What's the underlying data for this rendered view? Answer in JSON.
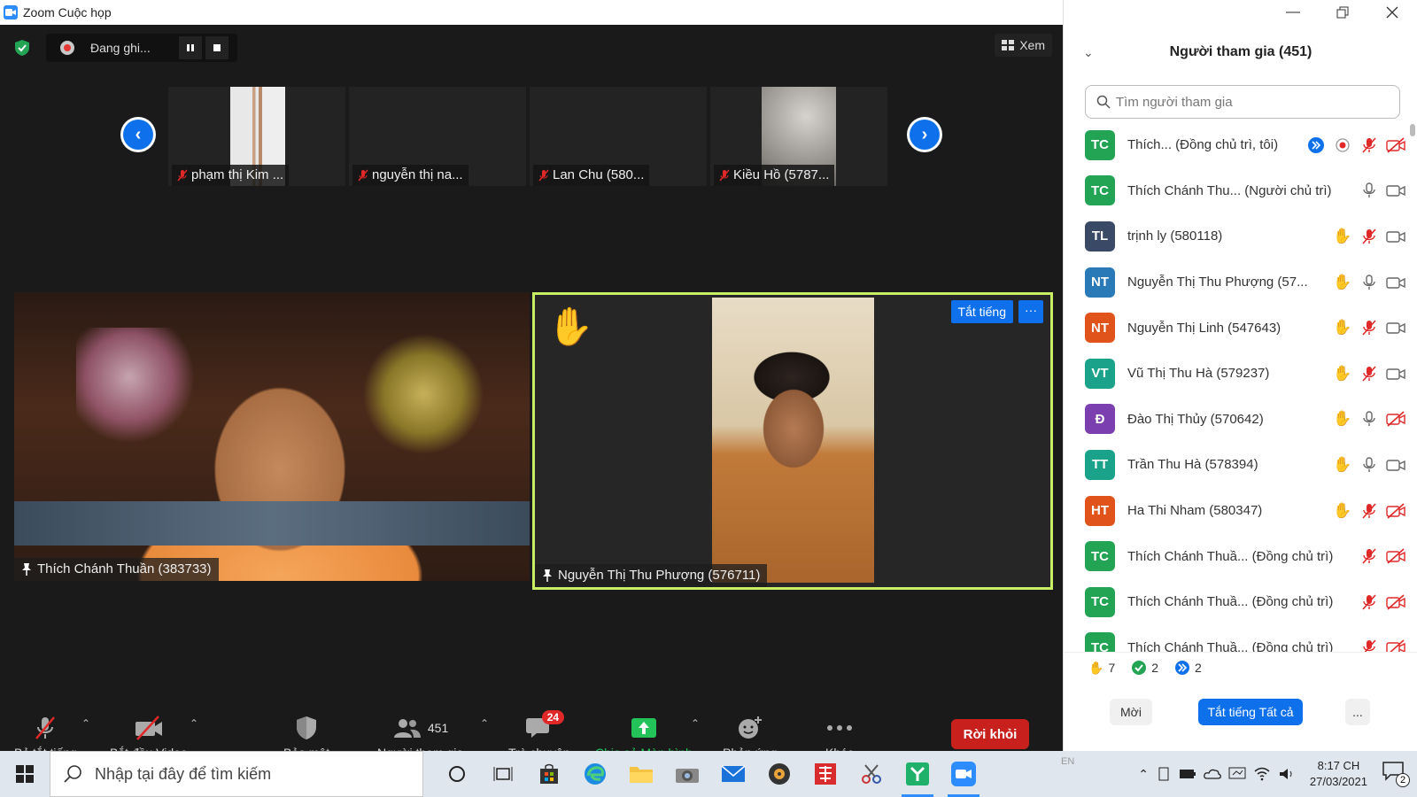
{
  "window": {
    "title": "Zoom Cuộc họp"
  },
  "topbar": {
    "recording_label": "Đang ghi...",
    "view_label": "Xem"
  },
  "gallery_strip": [
    {
      "name": "phạm thị Kim ..."
    },
    {
      "name": "nguyễn thị na..."
    },
    {
      "name": "Lan Chu (580..."
    },
    {
      "name": "Kiều Hồ (5787..."
    }
  ],
  "main_tiles": {
    "left": {
      "name": "Thích Chánh Thuần (383733)"
    },
    "right": {
      "name": "Nguyễn Thị Thu Phượng (576711)",
      "mute_label": "Tắt tiếng",
      "more_label": "···"
    }
  },
  "toolbar": {
    "mute_label": "Bỏ tắt tiếng",
    "video_label": "Bắt đầu Video",
    "security_label": "Bảo mật",
    "participants_label": "Người tham gia",
    "participants_count": "451",
    "chat_label": "Trò chuyện",
    "chat_badge": "24",
    "share_label": "Chia sẻ Màn hình",
    "reactions_label": "Phản ứng",
    "more_label": "Khác",
    "leave_label": "Rời khỏi"
  },
  "panel": {
    "title": "Người tham gia (451)",
    "search_placeholder": "Tìm người tham gia",
    "participants": [
      {
        "initials": "TC",
        "color": "#23a455",
        "name": "Thích... (Đồng chủ trì, tôi)",
        "hand": false,
        "mic": "muted",
        "video": "off",
        "extra": "cohost-self"
      },
      {
        "initials": "TC",
        "color": "#23a455",
        "name": "Thích Chánh Thu... (Người chủ trì)",
        "hand": false,
        "mic": "on",
        "video": "on",
        "extra": ""
      },
      {
        "initials": "TL",
        "color": "#3a4a66",
        "name": "trịnh ly (580118)",
        "hand": true,
        "mic": "muted",
        "video": "on",
        "extra": ""
      },
      {
        "initials": "NT",
        "color": "#2a7ab8",
        "name": "Nguyễn Thị Thu Phượng (57...",
        "hand": true,
        "mic": "on",
        "video": "on",
        "extra": ""
      },
      {
        "initials": "NT",
        "color": "#e0541c",
        "name": "Nguyễn Thị Linh (547643)",
        "hand": true,
        "mic": "muted",
        "video": "on",
        "extra": ""
      },
      {
        "initials": "VT",
        "color": "#1aa38a",
        "name": "Vũ Thị Thu Hà  (579237)",
        "hand": true,
        "mic": "muted",
        "video": "on",
        "extra": ""
      },
      {
        "initials": "Đ",
        "color": "#7b3fb0",
        "name": "Đào Thị Thủy (570642)",
        "hand": true,
        "mic": "on",
        "video": "off",
        "extra": ""
      },
      {
        "initials": "TT",
        "color": "#1aa38a",
        "name": "Trần Thu Hà (578394)",
        "hand": true,
        "mic": "on",
        "video": "on",
        "extra": ""
      },
      {
        "initials": "HT",
        "color": "#e0541c",
        "name": "Ha Thi Nham (580347)",
        "hand": true,
        "mic": "muted",
        "video": "off",
        "extra": ""
      },
      {
        "initials": "TC",
        "color": "#23a455",
        "name": "Thích Chánh Thuầ... (Đồng chủ trì)",
        "hand": false,
        "mic": "muted",
        "video": "off",
        "extra": ""
      },
      {
        "initials": "TC",
        "color": "#23a455",
        "name": "Thích Chánh Thuầ... (Đồng chủ trì)",
        "hand": false,
        "mic": "muted",
        "video": "off",
        "extra": ""
      },
      {
        "initials": "TC",
        "color": "#23a455",
        "name": "Thích Chánh Thuầ... (Đồng chủ trì)",
        "hand": false,
        "mic": "muted",
        "video": "off",
        "extra": ""
      }
    ],
    "footer": {
      "hand_count": "7",
      "yes_count": "2",
      "faster_count": "2",
      "invite_label": "Mời",
      "mute_all_label": "Tắt tiếng Tất cả",
      "more_label": "..."
    }
  },
  "taskbar": {
    "search_placeholder": "Nhập tại đây để tìm kiếm",
    "time": "8:17 CH",
    "date": "27/03/2021",
    "lang": "EN",
    "notification_count": "2"
  }
}
